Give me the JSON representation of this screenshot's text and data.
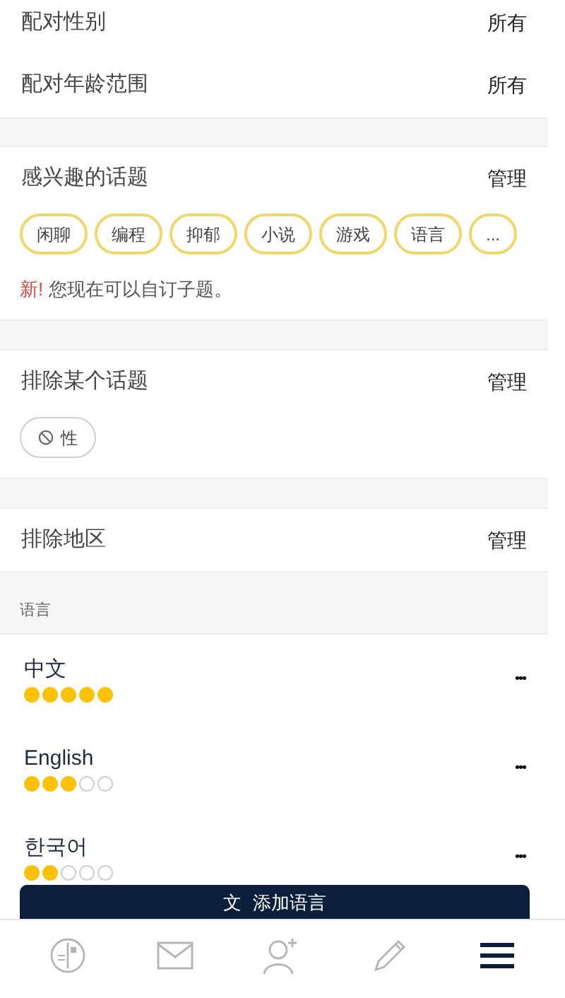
{
  "match_settings": [
    {
      "label": "配对性别",
      "value": "所有"
    },
    {
      "label": "配对年龄范围",
      "value": "所有"
    }
  ],
  "interest_topics": {
    "title": "感兴趣的话题",
    "action": "管理",
    "chips": [
      "闲聊",
      "编程",
      "抑郁",
      "小说",
      "游戏",
      "语言",
      "..."
    ],
    "new_badge": "新!",
    "note": "您现在可以自订子题。"
  },
  "excluded_topics": {
    "title": "排除某个话题",
    "action": "管理",
    "chips": [
      "性"
    ]
  },
  "excluded_regions": {
    "title": "排除地区",
    "action": "管理"
  },
  "languages_header": "语言",
  "languages": [
    {
      "name": "中文",
      "stars": 5,
      "menu": "•••"
    },
    {
      "name": "English",
      "stars": 3,
      "menu": "•••"
    },
    {
      "name": "한국어",
      "stars": 2,
      "menu": "•••"
    }
  ],
  "add_language_button": {
    "icon": "文",
    "label": "添加语言"
  },
  "tab_bar": [
    {
      "kind": "profile",
      "selected": false
    },
    {
      "kind": "mail",
      "selected": false
    },
    {
      "kind": "add-user",
      "selected": false
    },
    {
      "kind": "pencil",
      "selected": false
    },
    {
      "kind": "menu",
      "selected": true
    }
  ]
}
